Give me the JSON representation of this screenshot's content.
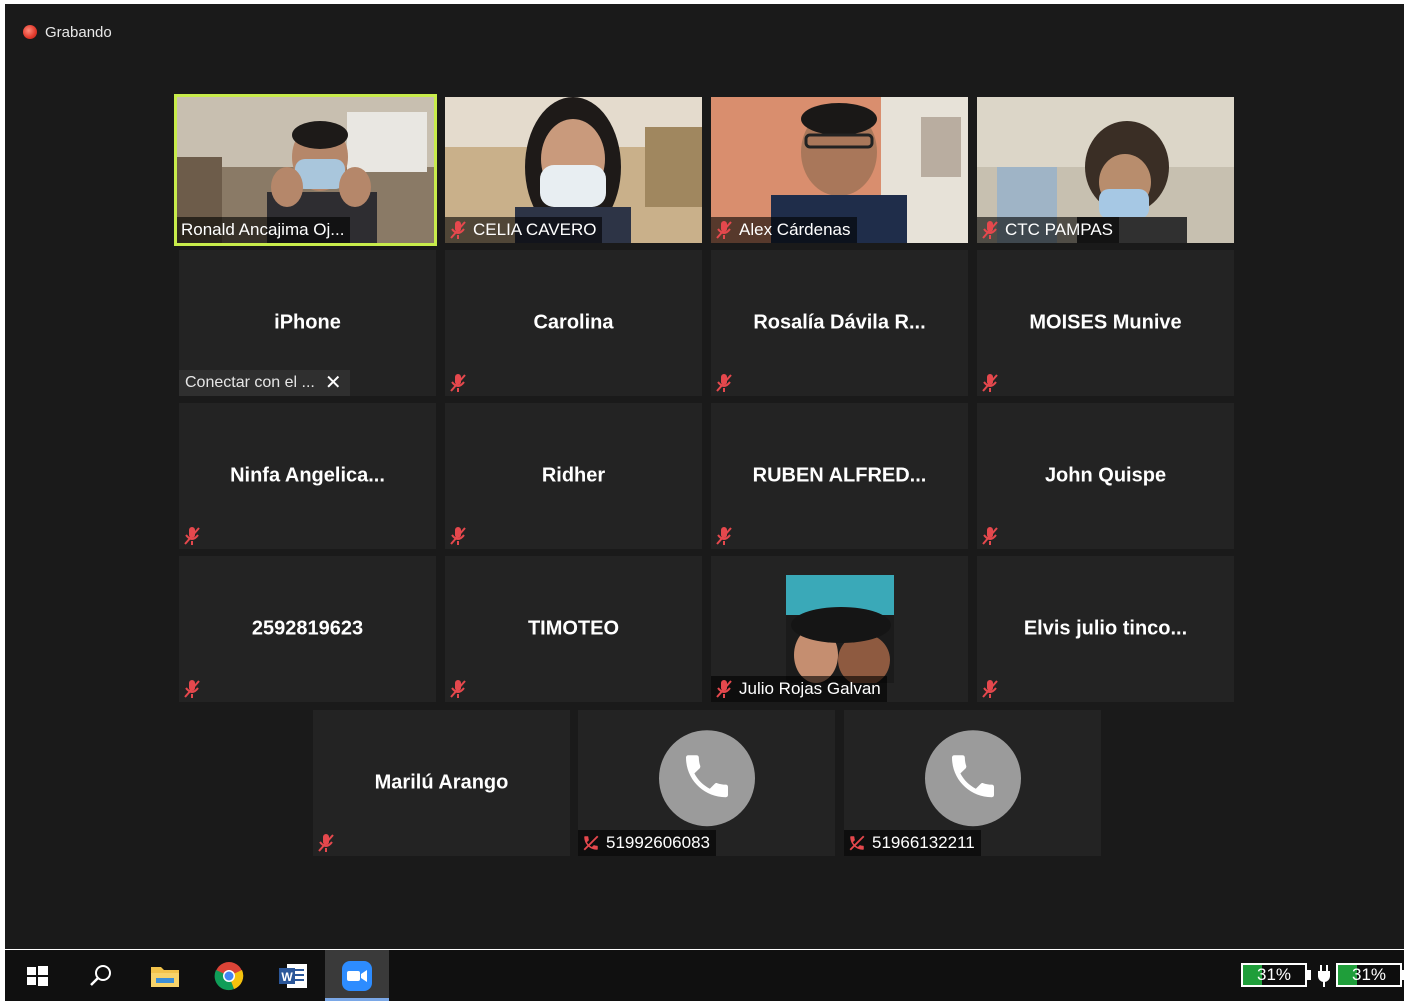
{
  "recording": {
    "label": "Grabando"
  },
  "tiles": [
    {
      "id": "ronald",
      "name": "Ronald Ancajima Oj...",
      "type": "video",
      "active": true,
      "muted": false
    },
    {
      "id": "celia",
      "name": "CELIA CAVERO",
      "type": "video",
      "muted": true
    },
    {
      "id": "alex",
      "name": "Alex Cárdenas",
      "type": "video",
      "muted": true
    },
    {
      "id": "ctc",
      "name": "CTC PAMPAS",
      "type": "video",
      "muted": true
    },
    {
      "id": "iphone",
      "name": "iPhone",
      "type": "name",
      "connect_prompt": "Conectar con el ...",
      "close_label": "✕"
    },
    {
      "id": "carolina",
      "name": "Carolina",
      "type": "name",
      "muted": true
    },
    {
      "id": "rosalia",
      "name": "Rosalía Dávila R...",
      "type": "name",
      "muted": true
    },
    {
      "id": "moises",
      "name": "MOISES Munive",
      "type": "name",
      "muted": true
    },
    {
      "id": "ninfa",
      "name": "Ninfa  Angelica...",
      "type": "name",
      "muted": true
    },
    {
      "id": "ridher",
      "name": "Ridher",
      "type": "name",
      "muted": true
    },
    {
      "id": "ruben",
      "name": "RUBEN ALFRED...",
      "type": "name",
      "muted": true
    },
    {
      "id": "john",
      "name": "John Quispe",
      "type": "name",
      "muted": true
    },
    {
      "id": "phone1",
      "name": "2592819623",
      "type": "name",
      "muted": true
    },
    {
      "id": "timoteo",
      "name": "TIMOTEO",
      "type": "name",
      "muted": true
    },
    {
      "id": "julio",
      "name": "Julio Rojas Galvan",
      "type": "avatar",
      "muted": true
    },
    {
      "id": "elvis",
      "name": "Elvis  julio  tinco...",
      "type": "name",
      "muted": true
    },
    {
      "id": "marilu",
      "name": "Marilú Arango",
      "type": "name",
      "muted": true
    },
    {
      "id": "call1",
      "name": "51992606083",
      "type": "phone",
      "muted": true
    },
    {
      "id": "call2",
      "name": "51966132211",
      "type": "phone",
      "muted": true
    }
  ],
  "taskbar": {
    "apps": [
      "windows-start-icon",
      "search-icon",
      "file-explorer-icon",
      "chrome-icon",
      "word-icon",
      "zoom-icon"
    ],
    "battery_1": "31%",
    "battery_2": "31%",
    "battery_level": 0.31
  },
  "colors": {
    "active_speaker": "#c8ec4b",
    "muted": "#e5484d",
    "battery": "#1f9e3a"
  }
}
